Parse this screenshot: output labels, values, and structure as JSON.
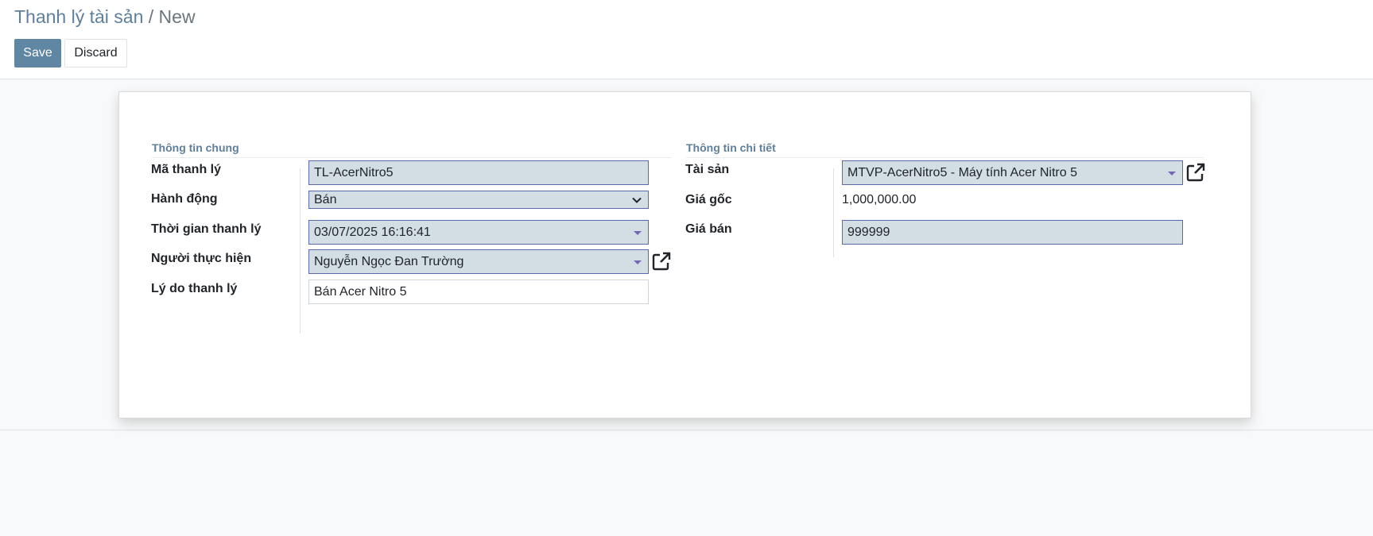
{
  "breadcrumb": {
    "parent": "Thanh lý tài sản",
    "separator": "/",
    "current": "New"
  },
  "toolbar": {
    "save_label": "Save",
    "discard_label": "Discard"
  },
  "form": {
    "general": {
      "title": "Thông tin chung",
      "ma_thanh_ly": {
        "label": "Mã thanh lý",
        "value": "TL-AcerNitro5"
      },
      "hanh_dong": {
        "label": "Hành động",
        "value": "Bán"
      },
      "thoi_gian": {
        "label": "Thời gian thanh lý",
        "value": "03/07/2025 16:16:41"
      },
      "nguoi_thuc_hien": {
        "label": "Người thực hiện",
        "value": "Nguyễn Ngọc Đan Trường"
      },
      "ly_do": {
        "label": "Lý do thanh lý",
        "value": "Bán Acer Nitro 5"
      }
    },
    "detail": {
      "title": "Thông tin chi tiết",
      "tai_san": {
        "label": "Tài sản",
        "value": "MTVP-AcerNitro5 - Máy tính Acer Nitro 5"
      },
      "gia_goc": {
        "label": "Giá gốc",
        "value": "1,000,000.00"
      },
      "gia_ban": {
        "label": "Giá bán",
        "value": "999999"
      }
    }
  },
  "colors": {
    "primary": "#5f86a2",
    "field_bg": "#d2dde4",
    "field_border": "#5a6aa8",
    "caret": "#7467b1",
    "section_title": "#5f7f9c"
  },
  "icons": {
    "dropdown": "caret-down-icon",
    "select": "chevron-down-icon",
    "external": "external-link-icon"
  }
}
